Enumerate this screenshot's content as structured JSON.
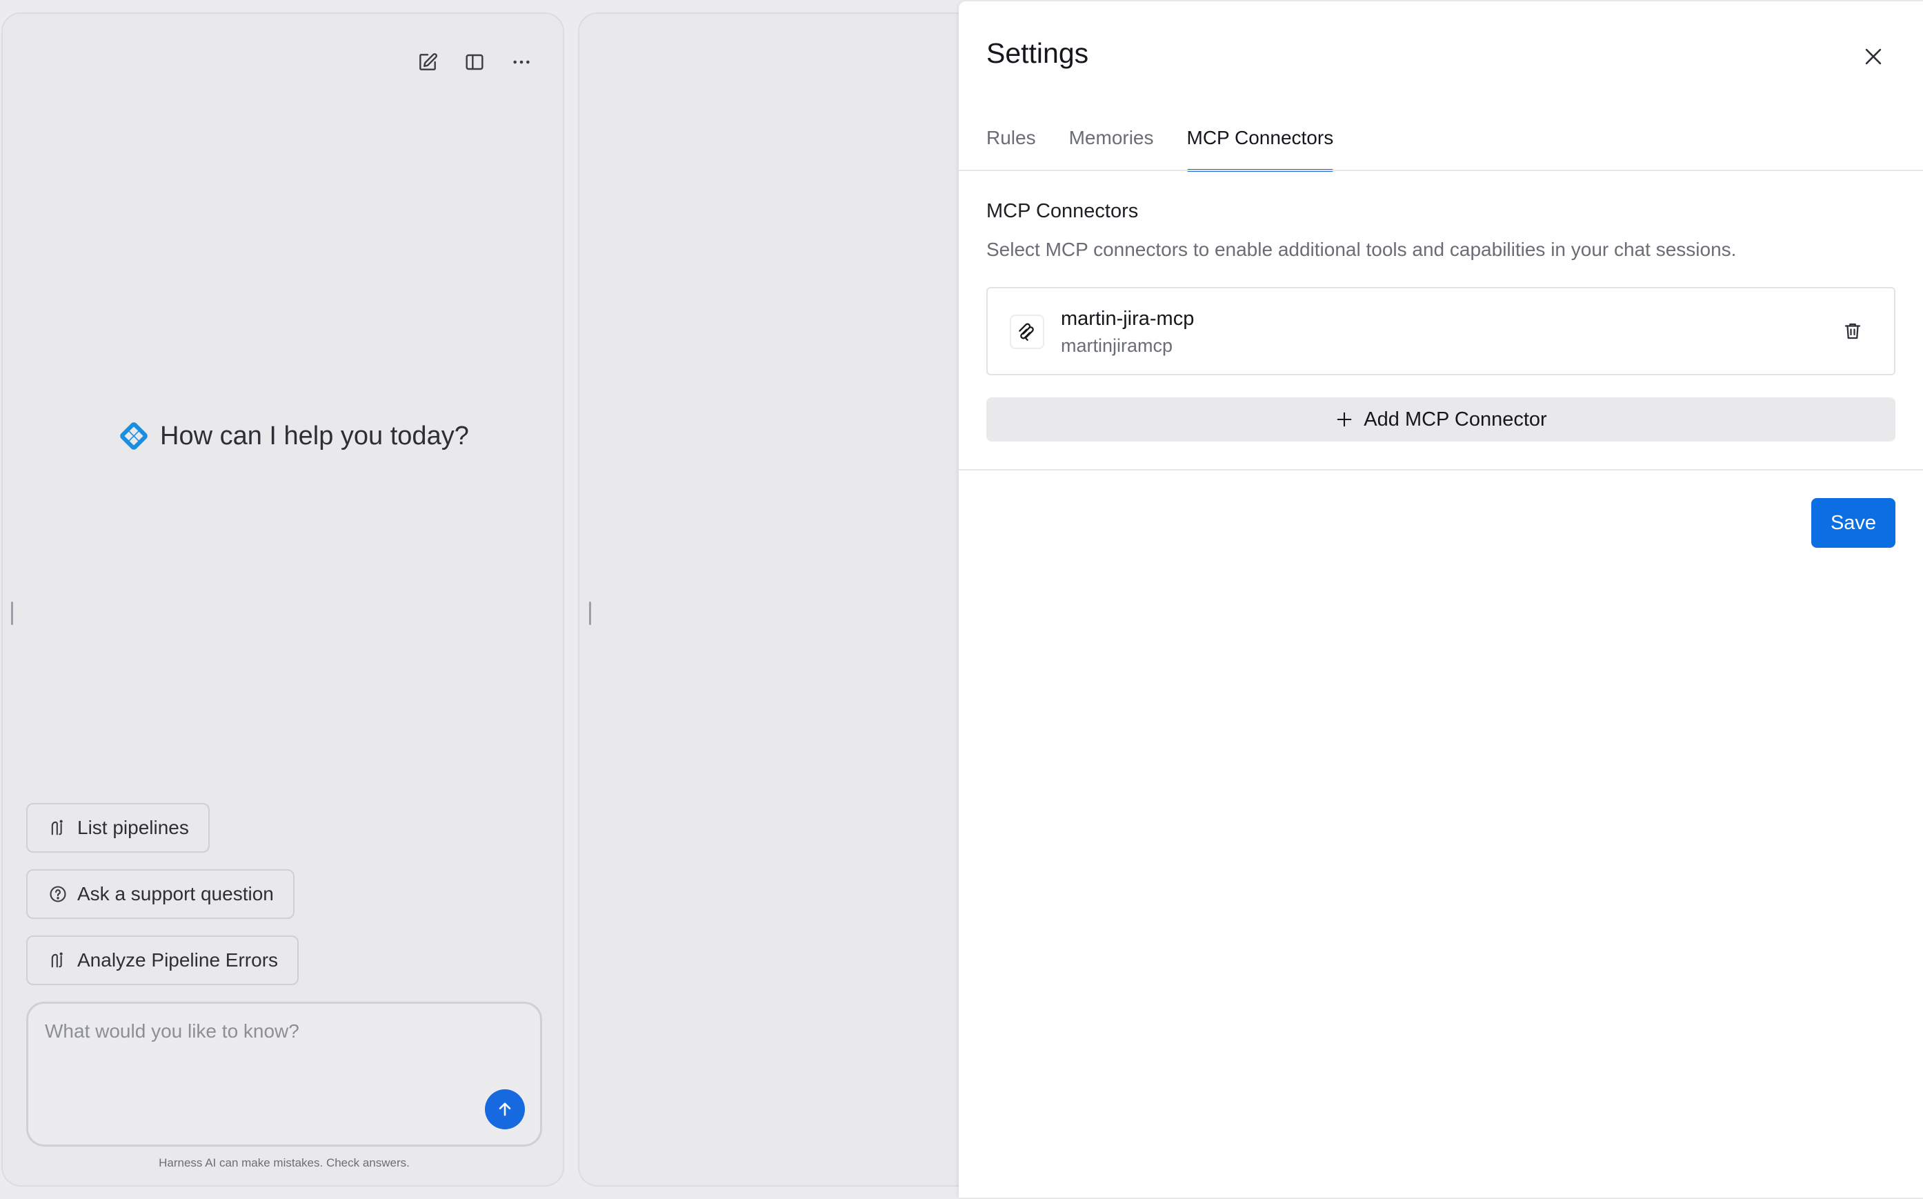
{
  "chat": {
    "toolbar": {
      "new_chat_icon": "edit-square-icon",
      "toggle_panel_icon": "sidebar-panel-icon",
      "more_icon": "more-horizontal-icon"
    },
    "greeting": "How can I help you today?",
    "suggestions": [
      {
        "label": "List pipelines",
        "icon": "pipeline-icon"
      },
      {
        "label": "Ask a support question",
        "icon": "help-circle-icon"
      },
      {
        "label": "Analyze Pipeline Errors",
        "icon": "pipeline-icon"
      }
    ],
    "composer": {
      "placeholder": "What would you like to know?",
      "value": ""
    },
    "disclaimer": "Harness AI can make mistakes. Check answers."
  },
  "settings": {
    "title": "Settings",
    "tabs": [
      {
        "label": "Rules",
        "active": false
      },
      {
        "label": "Memories",
        "active": false
      },
      {
        "label": "MCP Connectors",
        "active": true
      }
    ],
    "section_title": "MCP Connectors",
    "section_description": "Select MCP connectors to enable additional tools and capabilities in your chat sessions.",
    "connectors": [
      {
        "name": "martin-jira-mcp",
        "identifier": "martinjiramcp",
        "icon": "mcp-logo-icon"
      }
    ],
    "add_button_label": "Add MCP Connector",
    "save_button_label": "Save"
  },
  "colors": {
    "accent": "#1769e0",
    "save_button": "#0b6ee3",
    "greeting_icon": "#1a8fe0"
  }
}
